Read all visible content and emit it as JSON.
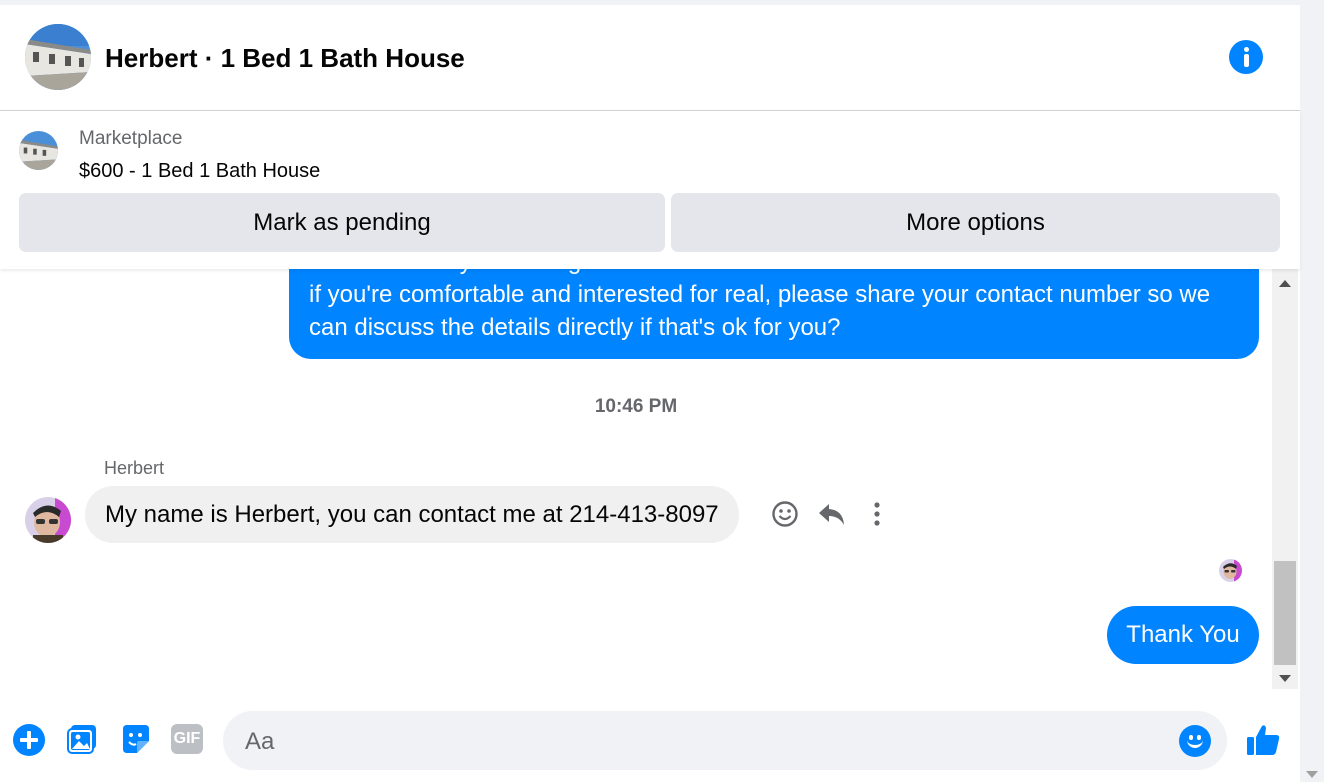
{
  "header": {
    "title": "Herbert · 1 Bed 1 Bath House"
  },
  "marketplace": {
    "label": "Marketplace",
    "listing": "$600 - 1 Bed 1 Bath House",
    "mark_pending_label": "Mark as pending",
    "more_options_label": "More options"
  },
  "conversation": {
    "outgoing_lines": [
      "how soon are you looking to move on?",
      "if you're comfortable and interested for real, please share your contact number so we",
      "can discuss the details directly if that's ok for you?"
    ],
    "timestamp": "10:46 PM",
    "sender_name": "Herbert",
    "incoming_message": "My name is Herbert, you can contact me at 214-413-8097",
    "reply_message": "Thank You"
  },
  "composer": {
    "placeholder": "Aa",
    "gif_label": "GIF"
  },
  "colors": {
    "accent": "#0084ff",
    "incoming_bubble": "#f0f0f0",
    "button_bg": "#e4e6eb",
    "secondary_text": "#65676b"
  },
  "icons": [
    "info-icon",
    "react-emoji-icon",
    "reply-icon",
    "more-vertical-icon",
    "plus-icon",
    "photo-icon",
    "sticker-icon",
    "gif-icon",
    "emoji-icon",
    "thumbs-up-icon"
  ]
}
